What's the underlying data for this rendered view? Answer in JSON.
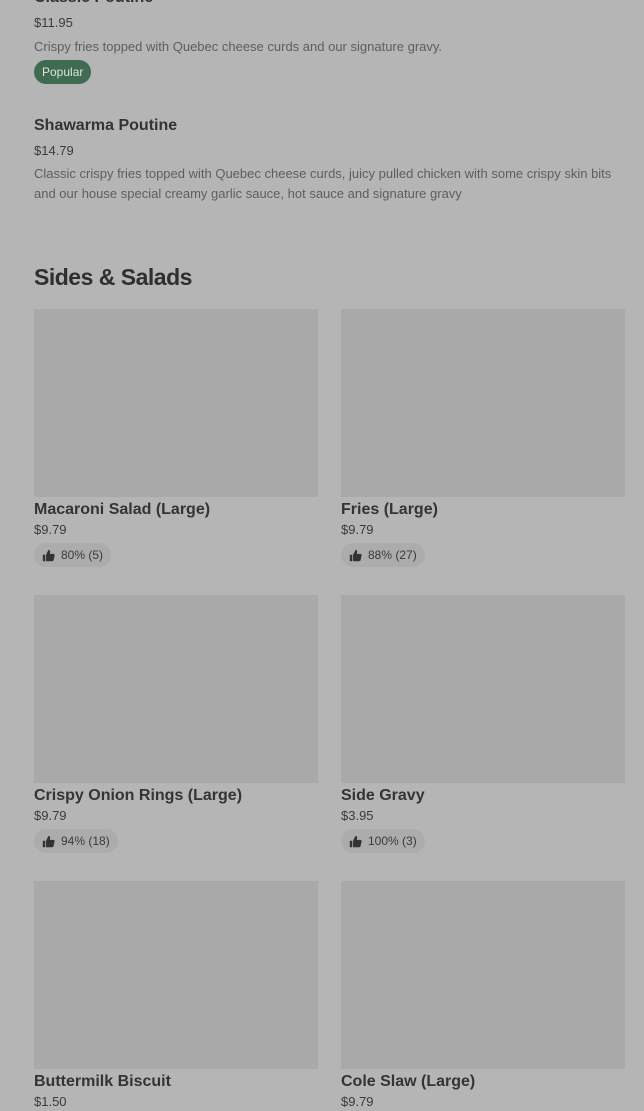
{
  "featured_items": [
    {
      "name": "Classic Poutine",
      "price": "$11.95",
      "description": "Crispy fries topped with Quebec cheese curds and our signature gravy.",
      "badge": "Popular"
    },
    {
      "name": "Shawarma Poutine",
      "price": "$14.79",
      "description": "Classic crispy fries topped with Quebec cheese curds, juicy pulled chicken with some crispy skin bits and our house special creamy garlic sauce, hot sauce and signature gravy"
    }
  ],
  "section": {
    "title": "Sides & Salads"
  },
  "cards": [
    {
      "name": "Macaroni Salad (Large)",
      "price": "$9.79",
      "rating": "80% (5)"
    },
    {
      "name": "Fries (Large)",
      "price": "$9.79",
      "rating": "88% (27)"
    },
    {
      "name": "Crispy Onion Rings (Large)",
      "price": "$9.79",
      "rating": "94% (18)"
    },
    {
      "name": "Side Gravy",
      "price": "$3.95",
      "rating": "100% (3)"
    },
    {
      "name": "Buttermilk Biscuit",
      "price": "$1.50"
    },
    {
      "name": "Cole Slaw (Large)",
      "price": "$9.79"
    }
  ],
  "icons": {
    "rating": "thumbs-up-icon"
  },
  "colors": {
    "background": "#b5b5b5",
    "image_placeholder": "#a9a9a9",
    "badge_background": "#3f6b50",
    "rating_pill": "#acacac"
  }
}
